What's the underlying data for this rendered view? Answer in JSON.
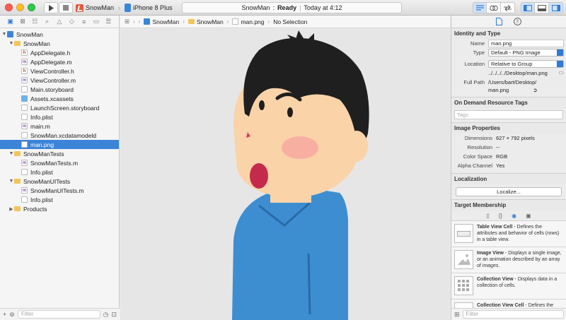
{
  "toolbar": {
    "project_name": "SnowMan",
    "device": "iPhone 8 Plus",
    "status_app": "SnowMan",
    "status_text": "Ready",
    "status_time": "Today at 4:12"
  },
  "navigator": {
    "filter_placeholder": "Filter",
    "items": [
      {
        "label": "SnowMan",
        "level": 0,
        "kind": "project",
        "expanded": true
      },
      {
        "label": "SnowMan",
        "level": 1,
        "kind": "folder",
        "expanded": true
      },
      {
        "label": "AppDelegate.h",
        "level": 2,
        "kind": "h"
      },
      {
        "label": "AppDelegate.m",
        "level": 2,
        "kind": "m"
      },
      {
        "label": "ViewController.h",
        "level": 2,
        "kind": "h"
      },
      {
        "label": "ViewController.m",
        "level": 2,
        "kind": "m"
      },
      {
        "label": "Main.storyboard",
        "level": 2,
        "kind": "doc"
      },
      {
        "label": "Assets.xcassets",
        "level": 2,
        "kind": "assets"
      },
      {
        "label": "LaunchScreen.storyboard",
        "level": 2,
        "kind": "doc"
      },
      {
        "label": "Info.plist",
        "level": 2,
        "kind": "doc"
      },
      {
        "label": "main.m",
        "level": 2,
        "kind": "m"
      },
      {
        "label": "SnowMan.xcdatamodeld",
        "level": 2,
        "kind": "doc"
      },
      {
        "label": "man.png",
        "level": 2,
        "kind": "doc",
        "selected": true
      },
      {
        "label": "SnowManTests",
        "level": 1,
        "kind": "folder",
        "expanded": true
      },
      {
        "label": "SnowManTests.m",
        "level": 2,
        "kind": "m"
      },
      {
        "label": "Info.plist",
        "level": 2,
        "kind": "doc"
      },
      {
        "label": "SnowManUITests",
        "level": 1,
        "kind": "folder",
        "expanded": true
      },
      {
        "label": "SnowManUITests.m",
        "level": 2,
        "kind": "m"
      },
      {
        "label": "Info.plist",
        "level": 2,
        "kind": "doc"
      },
      {
        "label": "Products",
        "level": 1,
        "kind": "folder",
        "expanded": false
      }
    ]
  },
  "jumpbar": {
    "crumbs": [
      "SnowMan",
      "SnowMan",
      "man.png"
    ],
    "selection": "No Selection"
  },
  "inspector": {
    "identity": {
      "title": "Identity and Type",
      "name_label": "Name",
      "name_value": "man.png",
      "type_label": "Type",
      "type_value": "Default - PNG Image",
      "location_label": "Location",
      "location_value": "Relative to Group",
      "location_path": "../../../../Desktop/man.png",
      "fullpath_label": "Full Path",
      "fullpath_value_1": "/Users/bart/Desktop/",
      "fullpath_value_2": "man.png"
    },
    "tags": {
      "title": "On Demand Resource Tags",
      "placeholder": "Tags"
    },
    "image_props": {
      "title": "Image Properties",
      "dimensions_label": "Dimensions",
      "dimensions_value": "627 × 792 pixels",
      "resolution_label": "Resolution",
      "resolution_value": "--",
      "colorspace_label": "Color Space",
      "colorspace_value": "RGB",
      "alpha_label": "Alpha Channel",
      "alpha_value": "Yes"
    },
    "localization": {
      "title": "Localization",
      "button": "Localize..."
    },
    "membership": {
      "title": "Target Membership"
    },
    "library": [
      {
        "title": "Table View Cell",
        "desc": " - Defines the attributes and behavior of cells (rows) in a table view."
      },
      {
        "title": "Image View",
        "desc": " - Displays a single image, or an animation described by an array of images."
      },
      {
        "title": "Collection View",
        "desc": " - Displays data in a collection of cells."
      },
      {
        "title": "Collection View Cell",
        "desc": " - Defines the"
      }
    ],
    "filter_placeholder": "Filter"
  }
}
